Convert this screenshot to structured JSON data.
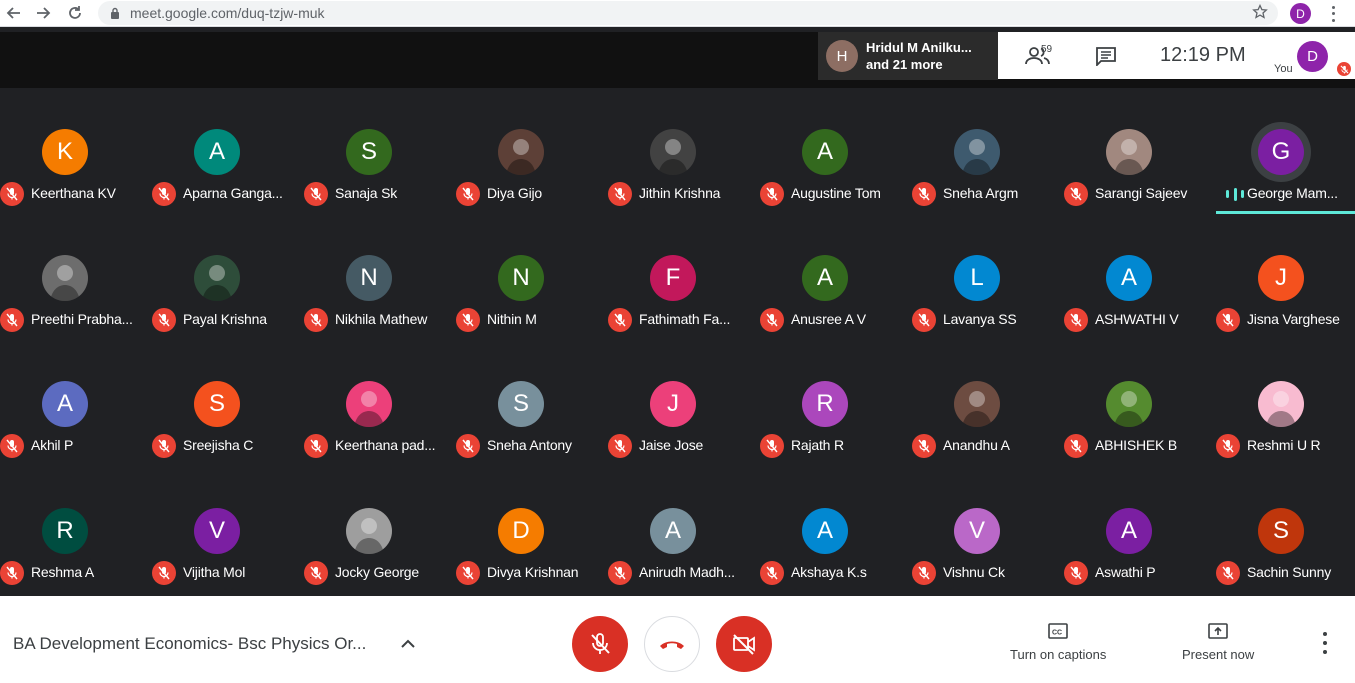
{
  "browser": {
    "url": "meet.google.com/duq-tzjw-muk",
    "profile_initial": "D"
  },
  "top": {
    "speaker_initial": "H",
    "speaker_line1": "Hridul M Anilku...",
    "speaker_line2": "and 21 more",
    "people_count": "59",
    "clock": "12:19  PM",
    "self_initial": "D",
    "self_label": "You"
  },
  "participants": [
    {
      "name": "Keerthana KV",
      "initial": "K",
      "color": "#f57c00",
      "photo": false
    },
    {
      "name": "Aparna Ganga...",
      "initial": "A",
      "color": "#00897b",
      "photo": false
    },
    {
      "name": "Sanaja Sk",
      "initial": "S",
      "color": "#33691e",
      "photo": false
    },
    {
      "name": "Diya Gijo",
      "initial": "",
      "color": "#5d4037",
      "photo": true
    },
    {
      "name": "Jithin Krishna",
      "initial": "",
      "color": "#424242",
      "photo": true
    },
    {
      "name": "Augustine Tom",
      "initial": "A",
      "color": "#33691e",
      "photo": false
    },
    {
      "name": "Sneha Argm",
      "initial": "",
      "color": "#3e5a6e",
      "photo": true
    },
    {
      "name": "Sarangi Sajeev",
      "initial": "",
      "color": "#a1887f",
      "photo": true
    },
    {
      "name": "George Mam...",
      "initial": "G",
      "color": "#7b1fa2",
      "photo": false,
      "speaking": true
    },
    {
      "name": "Preethi Prabha...",
      "initial": "",
      "color": "#6d6d6d",
      "photo": true
    },
    {
      "name": "Payal Krishna",
      "initial": "",
      "color": "#2e4d3a",
      "photo": true
    },
    {
      "name": "Nikhila Mathew",
      "initial": "N",
      "color": "#455a64",
      "photo": false
    },
    {
      "name": "Nithin M",
      "initial": "N",
      "color": "#33691e",
      "photo": false
    },
    {
      "name": "Fathimath Fa...",
      "initial": "F",
      "color": "#c2185b",
      "photo": false
    },
    {
      "name": "Anusree A V",
      "initial": "A",
      "color": "#33691e",
      "photo": false
    },
    {
      "name": "Lavanya SS",
      "initial": "L",
      "color": "#0288d1",
      "photo": false
    },
    {
      "name": "ASHWATHI V",
      "initial": "A",
      "color": "#0288d1",
      "photo": false
    },
    {
      "name": "Jisna Varghese",
      "initial": "J",
      "color": "#f4511e",
      "photo": false
    },
    {
      "name": "Akhil P",
      "initial": "A",
      "color": "#5c6bc0",
      "photo": false
    },
    {
      "name": "Sreejisha C",
      "initial": "S",
      "color": "#f4511e",
      "photo": false
    },
    {
      "name": "Keerthana pad...",
      "initial": "",
      "color": "#ec407a",
      "photo": true
    },
    {
      "name": "Sneha Antony",
      "initial": "S",
      "color": "#78909c",
      "photo": false
    },
    {
      "name": "Jaise Jose",
      "initial": "J",
      "color": "#ec407a",
      "photo": false
    },
    {
      "name": "Rajath R",
      "initial": "R",
      "color": "#ab47bc",
      "photo": false
    },
    {
      "name": "Anandhu A",
      "initial": "",
      "color": "#6d4c41",
      "photo": true
    },
    {
      "name": "ABHISHEK B",
      "initial": "",
      "color": "#558b2f",
      "photo": true
    },
    {
      "name": "Reshmi U R",
      "initial": "",
      "color": "#f8bbd0",
      "photo": true
    },
    {
      "name": "Reshma A",
      "initial": "R",
      "color": "#004d40",
      "photo": false
    },
    {
      "name": "Vijitha Mol",
      "initial": "V",
      "color": "#7b1fa2",
      "photo": false
    },
    {
      "name": "Jocky George",
      "initial": "",
      "color": "#9e9e9e",
      "photo": true
    },
    {
      "name": "Divya Krishnan",
      "initial": "D",
      "color": "#f57c00",
      "photo": false
    },
    {
      "name": "Anirudh Madh...",
      "initial": "A",
      "color": "#78909c",
      "photo": false
    },
    {
      "name": "Akshaya K.s",
      "initial": "A",
      "color": "#0288d1",
      "photo": false
    },
    {
      "name": "Vishnu Ck",
      "initial": "V",
      "color": "#ba68c8",
      "photo": false
    },
    {
      "name": "Aswathi P",
      "initial": "A",
      "color": "#7b1fa2",
      "photo": false
    },
    {
      "name": "Sachin Sunny",
      "initial": "S",
      "color": "#bf360c",
      "photo": false
    }
  ],
  "bottom": {
    "meeting_title": "BA Development Economics- Bsc Physics Or...",
    "captions_label": "Turn on captions",
    "present_label": "Present now"
  }
}
